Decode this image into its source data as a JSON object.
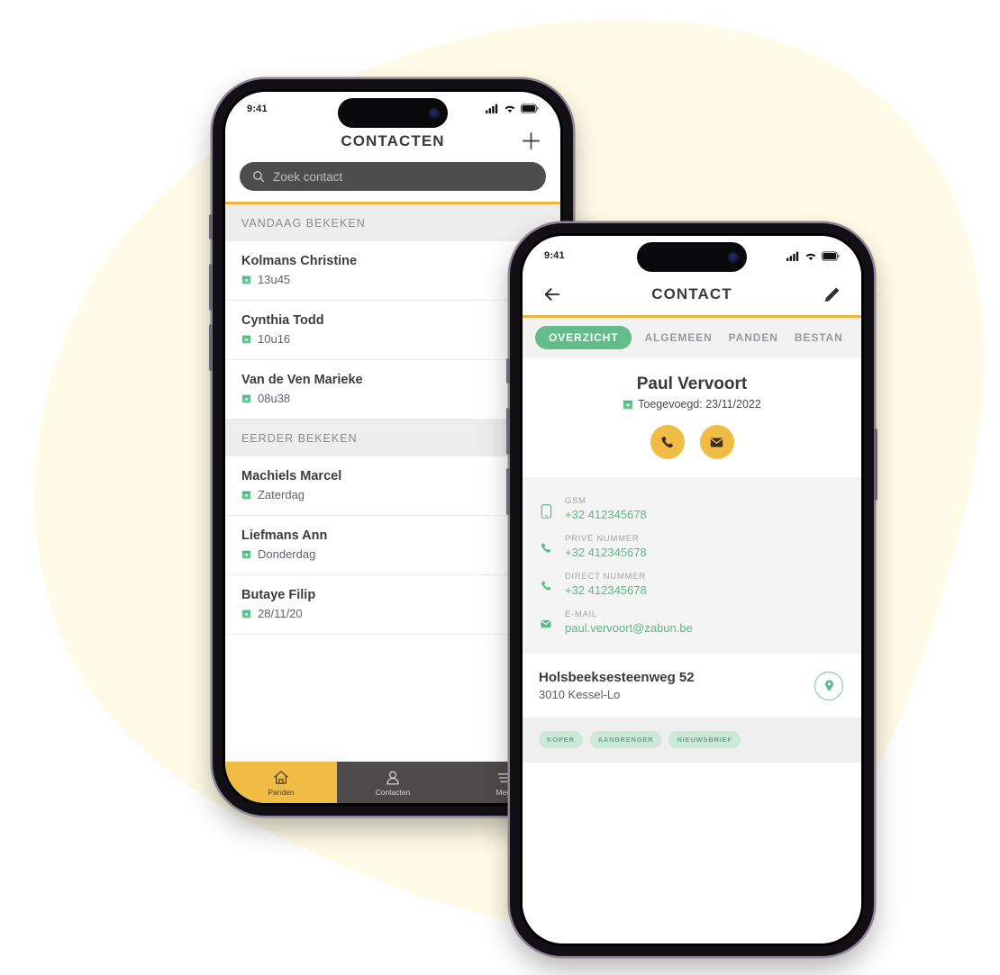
{
  "theme": {
    "blob_color": "#FFFBE6",
    "accent_yellow": "#F0BC43",
    "accent_green": "#62BD8A",
    "text_dark": "#3B3B3F",
    "search_bg": "#4D4D4D"
  },
  "phone_left": {
    "status": {
      "time": "9:41",
      "signal": "signal-icon",
      "wifi": "wifi-icon",
      "battery": "battery-icon"
    },
    "header": {
      "title": "CONTACTEN",
      "add_icon": "plus-icon"
    },
    "search": {
      "placeholder": "Zoek contact",
      "icon": "search-icon"
    },
    "sections": [
      {
        "label": "VANDAAG BEKEKEN",
        "rows": [
          {
            "name": "Kolmans Christine",
            "meta": "13u45",
            "meta_icon": "calendar-icon",
            "action_icon": "phone-icon"
          },
          {
            "name": "Cynthia Todd",
            "meta": "10u16",
            "meta_icon": "calendar-icon",
            "action_icon": "phone-icon"
          },
          {
            "name": "Van de Ven Marieke",
            "meta": "08u38",
            "meta_icon": "calendar-icon",
            "action_icon": "phone-icon"
          }
        ]
      },
      {
        "label": "EERDER BEKEKEN",
        "rows": [
          {
            "name": "Machiels Marcel",
            "meta": "Zaterdag",
            "meta_icon": "calendar-icon",
            "action_icon": "phone-icon"
          },
          {
            "name": "Liefmans Ann",
            "meta": "Donderdag",
            "meta_icon": "calendar-icon",
            "action_icon": "phone-icon"
          },
          {
            "name": "Butaye Filip",
            "meta": "28/11/20",
            "meta_icon": "calendar-icon",
            "action_icon": "phone-icon"
          }
        ]
      }
    ],
    "tabbar": [
      {
        "label": "Panden",
        "icon": "home-icon",
        "active": true
      },
      {
        "label": "Contacten",
        "icon": "person-icon",
        "active": false
      },
      {
        "label": "Meer",
        "icon": "menu-icon",
        "active": false
      }
    ]
  },
  "phone_right": {
    "status": {
      "time": "9:41",
      "signal": "signal-icon",
      "wifi": "wifi-icon",
      "battery": "battery-icon"
    },
    "header": {
      "title": "CONTACT",
      "back_icon": "arrow-left-icon",
      "edit_icon": "pencil-icon"
    },
    "tabs": [
      {
        "label": "OVERZICHT",
        "active": true
      },
      {
        "label": "ALGEMEEN",
        "active": false
      },
      {
        "label": "PANDEN",
        "active": false
      },
      {
        "label": "BESTAN",
        "active": false
      }
    ],
    "profile": {
      "name": "Paul Vervoort",
      "added_label": "Toegevoegd: 23/11/2022",
      "added_icon": "calendar-icon",
      "actions": [
        {
          "icon": "phone-icon",
          "name": "call"
        },
        {
          "icon": "envelope-icon",
          "name": "email"
        }
      ]
    },
    "contact_fields": [
      {
        "label": "GSM",
        "value": "+32 412345678",
        "icon": "mobile-icon"
      },
      {
        "label": "PRIVÉ NUMMER",
        "value": "+32 412345678",
        "icon": "phone-icon"
      },
      {
        "label": "DIRECT NUMMER",
        "value": "+32 412345678",
        "icon": "phone-icon"
      },
      {
        "label": "E-MAIL",
        "value": "paul.vervoort@zabun.be",
        "icon": "envelope-icon"
      }
    ],
    "address": {
      "line1": "Holsbeeksesteenweg 52",
      "line2": "3010 Kessel-Lo",
      "map_icon": "map-pin-icon"
    },
    "tags": [
      "KOPER",
      "AANBRENGER",
      "NIEUWSBRIEF"
    ]
  }
}
